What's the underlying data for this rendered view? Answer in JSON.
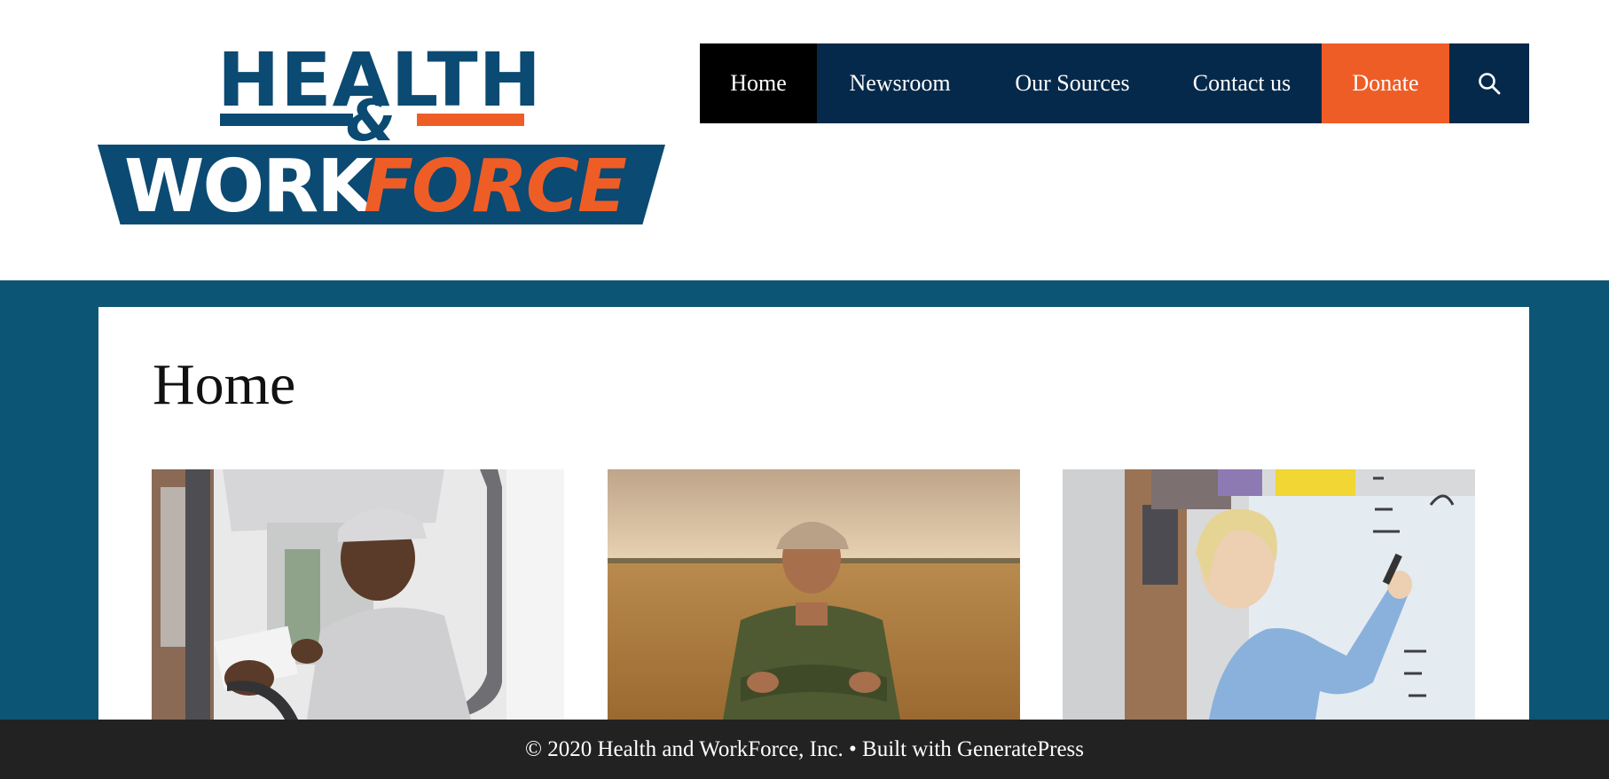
{
  "logo": {
    "line1": "HEALTH",
    "ampersand": "&",
    "line2_left": "WORK",
    "line2_right": "FORCE"
  },
  "nav": {
    "items": [
      {
        "label": "Home",
        "active": true
      },
      {
        "label": "Newsroom"
      },
      {
        "label": "Our Sources"
      },
      {
        "label": "Contact us"
      },
      {
        "label": "Donate",
        "highlight": true
      }
    ],
    "search_icon": "search-icon"
  },
  "page": {
    "title": "Home"
  },
  "footer": {
    "text": "© 2020 Health and WorkForce, Inc. • Built with GeneratePress"
  },
  "colors": {
    "brand_navy": "#05294a",
    "brand_blue": "#0b4a72",
    "band_teal": "#0c5575",
    "accent_orange": "#ef5d26",
    "footer_bg": "#222222"
  }
}
